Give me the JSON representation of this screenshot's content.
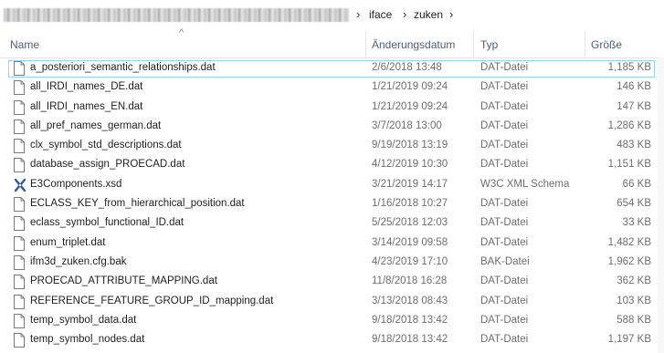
{
  "breadcrumb": {
    "items": [
      "iface",
      "zuken"
    ]
  },
  "columns": {
    "name": "Name",
    "date": "Änderungsdatum",
    "type": "Typ",
    "size": "Größe"
  },
  "files": [
    {
      "name": "a_posteriori_semantic_relationships.dat",
      "date": "2/6/2018 13:48",
      "type": "DAT-Datei",
      "size": "1,185 KB",
      "icon": "file-icon",
      "selected": true
    },
    {
      "name": "all_IRDI_names_DE.dat",
      "date": "1/21/2019 09:24",
      "type": "DAT-Datei",
      "size": "146 KB",
      "icon": "file-icon"
    },
    {
      "name": "all_IRDI_names_EN.dat",
      "date": "1/21/2019 09:24",
      "type": "DAT-Datei",
      "size": "147 KB",
      "icon": "file-icon"
    },
    {
      "name": "all_pref_names_german.dat",
      "date": "3/7/2018 13:00",
      "type": "DAT-Datei",
      "size": "1,286 KB",
      "icon": "file-icon"
    },
    {
      "name": "clx_symbol_std_descriptions.dat",
      "date": "9/19/2018 13:19",
      "type": "DAT-Datei",
      "size": "483 KB",
      "icon": "file-icon"
    },
    {
      "name": "database_assign_PROECAD.dat",
      "date": "4/12/2019 10:30",
      "type": "DAT-Datei",
      "size": "1,151 KB",
      "icon": "file-icon"
    },
    {
      "name": "E3Components.xsd",
      "date": "3/21/2019 14:17",
      "type": "W3C XML Schema",
      "size": "66 KB",
      "icon": "xml-schema-icon"
    },
    {
      "name": "ECLASS_KEY_from_hierarchical_position.dat",
      "date": "1/16/2018 10:27",
      "type": "DAT-Datei",
      "size": "654 KB",
      "icon": "file-icon"
    },
    {
      "name": "eclass_symbol_functional_ID.dat",
      "date": "5/25/2018 12:03",
      "type": "DAT-Datei",
      "size": "33 KB",
      "icon": "file-icon"
    },
    {
      "name": "enum_triplet.dat",
      "date": "3/14/2019 09:58",
      "type": "DAT-Datei",
      "size": "1,482 KB",
      "icon": "file-icon"
    },
    {
      "name": "ifm3d_zuken.cfg.bak",
      "date": "4/23/2019 17:10",
      "type": "BAK-Datei",
      "size": "1,962 KB",
      "icon": "file-icon"
    },
    {
      "name": "PROECAD_ATTRIBUTE_MAPPING.dat",
      "date": "11/8/2018 16:28",
      "type": "DAT-Datei",
      "size": "362 KB",
      "icon": "file-icon"
    },
    {
      "name": "REFERENCE_FEATURE_GROUP_ID_mapping.dat",
      "date": "3/13/2018 08:43",
      "type": "DAT-Datei",
      "size": "103 KB",
      "icon": "file-icon"
    },
    {
      "name": "temp_symbol_data.dat",
      "date": "9/18/2018 13:42",
      "type": "DAT-Datei",
      "size": "588 KB",
      "icon": "file-icon"
    },
    {
      "name": "temp_symbol_nodes.dat",
      "date": "9/18/2018 13:42",
      "type": "DAT-Datei",
      "size": "1,197 KB",
      "icon": "file-icon"
    }
  ]
}
